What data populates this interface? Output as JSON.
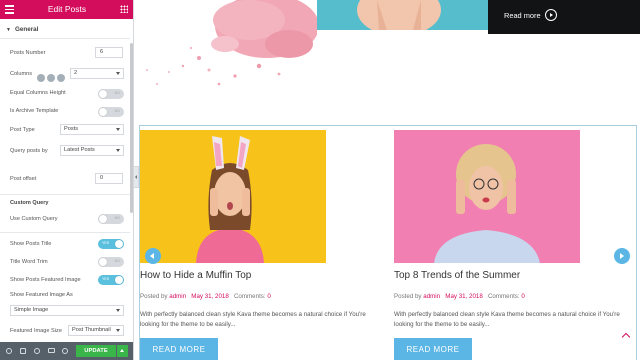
{
  "panel": {
    "title": "Edit Posts",
    "section_general": "General",
    "posts_number_label": "Posts Number",
    "posts_number_value": "6",
    "columns_label": "Columns",
    "columns_value": "2",
    "equal_columns_label": "Equal Columns Height",
    "is_archive_label": "Is Archive Template",
    "post_type_label": "Post Type",
    "post_type_value": "Posts",
    "query_by_label": "Query posts by",
    "query_by_value": "Latest Posts",
    "post_offset_label": "Post offset",
    "post_offset_value": "0",
    "custom_query_heading": "Custom Query",
    "use_custom_query_label": "Use Custom Query",
    "show_title_label": "Show Posts Title",
    "title_word_trim_label": "Title Word Trim",
    "show_featured_label": "Show Posts Featured Image",
    "show_featured_as_label": "Show Featured Image As",
    "featured_as_value": "Simple Image",
    "featured_size_label": "Featured Image Size",
    "featured_size_value": "Post Thumbnail",
    "toggle_no": "NO",
    "toggle_yes": "YES"
  },
  "footer": {
    "update_label": "UPDATE"
  },
  "hero": {
    "read_more": "Read more"
  },
  "posts": [
    {
      "title": "How to Hide a Muffin Top",
      "posted_by": "Posted by",
      "author": "admin",
      "date": "May 31, 2018",
      "comments_label": "Comments:",
      "comments": "0",
      "excerpt": "With perfectly balanced clean style Kava theme becomes a natural choice if You're looking for the theme to be easily...",
      "read_more": "READ MORE"
    },
    {
      "title": "Top 8 Trends of the Summer",
      "posted_by": "Posted by",
      "author": "admin",
      "date": "May 31, 2018",
      "comments_label": "Comments:",
      "comments": "0",
      "excerpt": "With perfectly balanced clean style Kava theme becomes a natural choice if You're looking for the theme to be easily...",
      "read_more": "READ MORE"
    }
  ],
  "colors": {
    "brand": "#d30c5c",
    "accent": "#5bb6e6",
    "update": "#39b54a"
  }
}
